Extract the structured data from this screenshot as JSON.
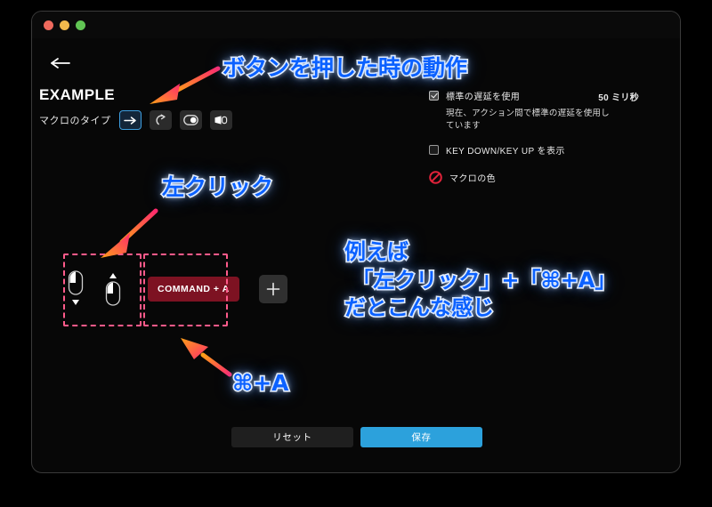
{
  "window": {
    "traffic_lights": [
      "close",
      "minimize",
      "maximize"
    ],
    "back_icon": "back-arrow-icon"
  },
  "header": {
    "title": "EXAMPLE",
    "macro_type_label": "マクロのタイプ",
    "type_buttons": [
      {
        "icon": "arrow-right-icon",
        "selected": true
      },
      {
        "icon": "loop-arrow-icon",
        "selected": false
      },
      {
        "icon": "toggle-switch-icon",
        "selected": false
      },
      {
        "icon": "mouse-hand-icon",
        "selected": false
      }
    ]
  },
  "options": {
    "default_delay_label": "標準の遅延を使用",
    "default_delay_checked": true,
    "delay_value": "50 ミリ秒",
    "delay_description": "現在、アクション間で標準の遅延を使用しています",
    "key_events_label": "KEY DOWN/KEY UP を表示",
    "key_events_checked": false,
    "macro_color_label": "マクロの色",
    "macro_color_icon": "no-entry-icon"
  },
  "actions": {
    "mouse_down_icon": "mouse-left-click-down-icon",
    "mouse_up_icon": "mouse-left-click-up-icon",
    "key_chip_label": "COMMAND + A",
    "add_button_icon": "plus-icon"
  },
  "footer": {
    "reset_label": "リセット",
    "save_label": "保存"
  },
  "annotations": {
    "top": "ボタンを押した時の動作",
    "left_click": "左クリック",
    "example": "例えば\n 「左クリック」+「⌘+A」\nだとこんな感じ",
    "command_a": "⌘+A"
  },
  "colors": {
    "accent_blue": "#2ca1dc",
    "annotation_blue": "#0b61ff",
    "key_chip_red": "#7d1222",
    "dash_pink": "#ff5a8a",
    "dash_orange": "#ff9a2e",
    "selected_border": "#3e9fe0"
  }
}
